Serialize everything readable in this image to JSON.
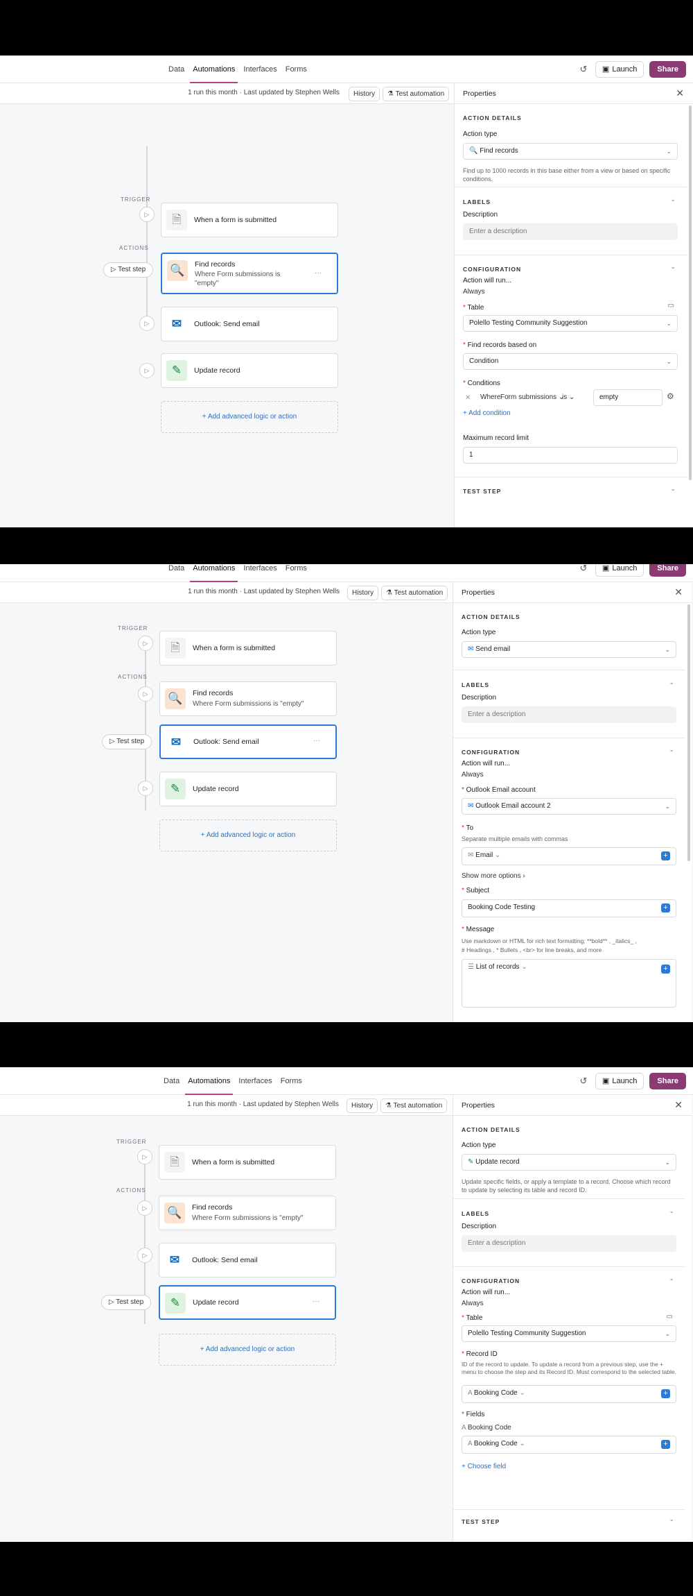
{
  "nav": {
    "tabs": [
      "Data",
      "Automations",
      "Interfaces",
      "Forms"
    ],
    "launch": "Launch",
    "share": "Share"
  },
  "subbar": {
    "run_info": "1 run this month · Last updated by Stephen Wells",
    "history": "History",
    "test_automation": "Test automation"
  },
  "workflow": {
    "trigger_label": "TRIGGER",
    "actions_label": "ACTIONS",
    "test_step": "Test step",
    "trigger_title": "When a form is submitted",
    "find_title": "Find records",
    "find_sub": "Where Form submissions is \"empty\"",
    "outlook_title": "Outlook: Send email",
    "update_title": "Update record",
    "add_logic": "+ Add advanced logic or action",
    "more": "···"
  },
  "panel": {
    "title": "Properties",
    "action_details": "ACTION DETAILS",
    "action_type": "Action type",
    "labels": "LABELS",
    "description": "Description",
    "description_placeholder": "Enter a description",
    "configuration": "CONFIGURATION",
    "action_will_run": "Action will run...",
    "always": "Always",
    "test_step": "TEST STEP"
  },
  "frame1": {
    "action_value": "Find records",
    "action_desc": "Find up to 1000 records in this base either from a view or based on specific conditions.",
    "table_label": "Table",
    "table_value": "Polello Testing Community Suggestion",
    "find_based_label": "Find records based on",
    "find_based_value": "Condition",
    "conditions_label": "Conditions",
    "cond_where": "Where",
    "cond_field": "Form submissions",
    "cond_op": "is",
    "cond_value": "empty",
    "add_condition": "+ Add condition",
    "max_limit_label": "Maximum record limit",
    "max_limit_value": "1"
  },
  "frame2": {
    "action_value": "Send email",
    "account_label": "Outlook Email account",
    "account_value": "Outlook Email account 2",
    "to_label": "To",
    "to_hint": "Separate multiple emails with commas",
    "to_pill": "Email",
    "show_more": "Show more options",
    "subject_label": "Subject",
    "subject_value": "Booking Code Testing",
    "message_label": "Message",
    "message_hint_1": "Use markdown or HTML for rich text formatting: **bold** , _italics_ ,",
    "message_hint_2": "# Headings , * Bullets , <br> for line breaks, and more",
    "message_pill": "List of records"
  },
  "frame3": {
    "action_value": "Update record",
    "action_desc": "Update specific fields, or apply a template to a record. Choose which record to update by selecting its table and record ID.",
    "table_label": "Table",
    "table_value": "Polello Testing Community Suggestion",
    "record_id_label": "Record ID",
    "record_id_hint": "ID of the record to update. To update a record from a previous step, use the + menu to choose the step and its Record ID. Must correspond to the selected table.",
    "record_id_pill": "Booking Code",
    "fields_label": "Fields",
    "field_name": "Booking Code",
    "field_pill": "Booking Code",
    "choose_field": "+ Choose field"
  }
}
